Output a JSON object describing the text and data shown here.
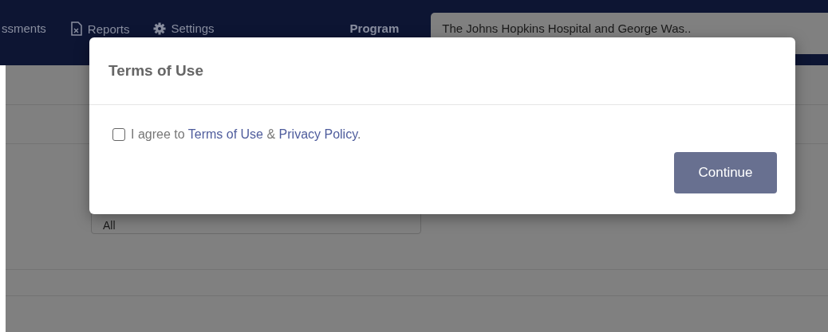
{
  "navbar": {
    "items": [
      {
        "label": "ssments"
      },
      {
        "label": "Reports"
      },
      {
        "label": "Settings"
      }
    ],
    "program_label": "Program",
    "program_value": "The Johns Hopkins Hospital and George Was.."
  },
  "filter": {
    "value": "All"
  },
  "modal": {
    "title": "Terms of Use",
    "consent": {
      "checked": false,
      "segments": [
        {
          "kind": "text",
          "text": "I agree to"
        },
        {
          "kind": "link",
          "text": "Terms of Use"
        },
        {
          "kind": "text",
          "text": "&"
        },
        {
          "kind": "link",
          "text": "Privacy Policy"
        },
        {
          "kind": "text",
          "text": "."
        }
      ]
    },
    "button": "Continue"
  }
}
